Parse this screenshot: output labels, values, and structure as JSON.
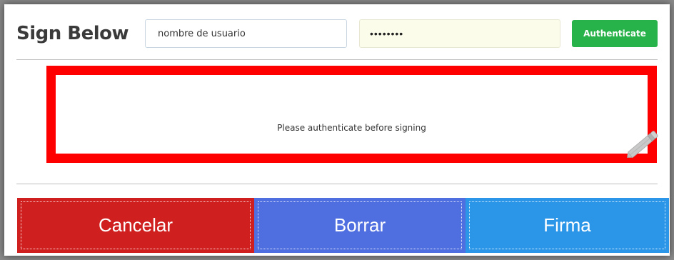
{
  "header": {
    "title": "Sign Below"
  },
  "login": {
    "username_value": "nombre de usuario",
    "password_value": "••••••••",
    "authenticate_label": "Authenticate"
  },
  "signature_pad": {
    "message": "Please authenticate before signing",
    "border_color": "#ff0000",
    "icon": "pencil-icon"
  },
  "actions": {
    "cancel_label": "Cancelar",
    "clear_label": "Borrar",
    "sign_label": "Firma",
    "colors": {
      "cancel": "#cf1f1f",
      "clear": "#4f6fe0",
      "sign": "#2b95e8",
      "authenticate": "#27b24a"
    }
  }
}
